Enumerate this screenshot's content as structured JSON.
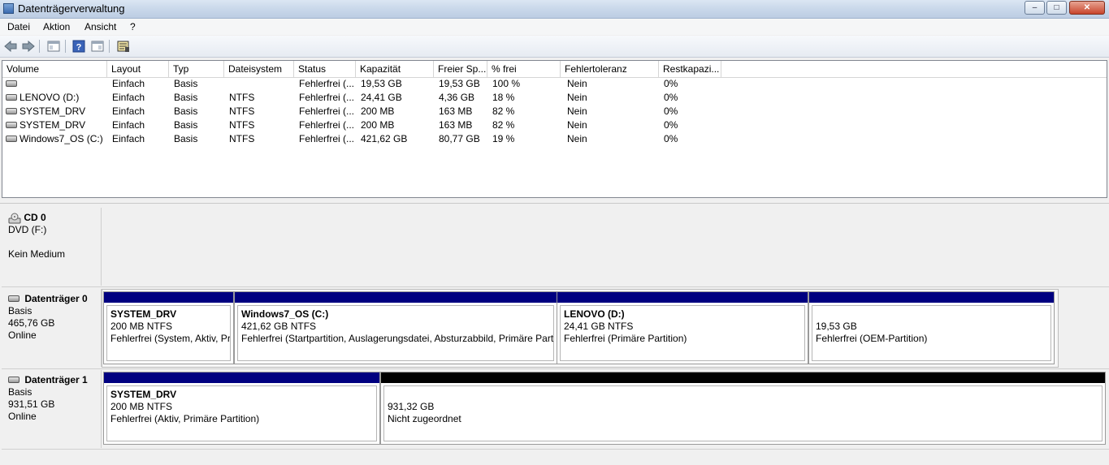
{
  "window": {
    "title": "Datenträgerverwaltung",
    "btn_min": "–",
    "btn_max": "□",
    "btn_close": "✕"
  },
  "menu": [
    "Datei",
    "Aktion",
    "Ansicht",
    "?"
  ],
  "toolbar": [
    "back-icon",
    "forward-icon",
    "console-tree-icon",
    "help-icon",
    "properties-icon",
    "disk-settings-icon"
  ],
  "columns": [
    "Volume",
    "Layout",
    "Typ",
    "Dateisystem",
    "Status",
    "Kapazität",
    "Freier Sp...",
    "% frei",
    "Fehlertoleranz",
    "Restkapazi..."
  ],
  "volumes": [
    {
      "volume": "",
      "layout": "Einfach",
      "typ": "Basis",
      "fs": "",
      "status": "Fehlerfrei (...",
      "kap": "19,53 GB",
      "frei": "19,53 GB",
      "pct": "100 %",
      "fehler": "Nein",
      "rest": "0%"
    },
    {
      "volume": "LENOVO (D:)",
      "layout": "Einfach",
      "typ": "Basis",
      "fs": "NTFS",
      "status": "Fehlerfrei (...",
      "kap": "24,41 GB",
      "frei": "4,36 GB",
      "pct": "18 %",
      "fehler": "Nein",
      "rest": "0%"
    },
    {
      "volume": "SYSTEM_DRV",
      "layout": "Einfach",
      "typ": "Basis",
      "fs": "NTFS",
      "status": "Fehlerfrei (...",
      "kap": "200 MB",
      "frei": "163 MB",
      "pct": "82 %",
      "fehler": "Nein",
      "rest": "0%"
    },
    {
      "volume": "SYSTEM_DRV",
      "layout": "Einfach",
      "typ": "Basis",
      "fs": "NTFS",
      "status": "Fehlerfrei (...",
      "kap": "200 MB",
      "frei": "163 MB",
      "pct": "82 %",
      "fehler": "Nein",
      "rest": "0%"
    },
    {
      "volume": "Windows7_OS (C:)",
      "layout": "Einfach",
      "typ": "Basis",
      "fs": "NTFS",
      "status": "Fehlerfrei (...",
      "kap": "421,62 GB",
      "frei": "80,77 GB",
      "pct": "19 %",
      "fehler": "Nein",
      "rest": "0%"
    }
  ],
  "disks": {
    "cd0": {
      "title": "CD 0",
      "line1": "DVD (F:)",
      "line2": "Kein Medium"
    },
    "disk0": {
      "title": "Datenträger 0",
      "type": "Basis",
      "size": "465,76 GB",
      "state": "Online",
      "partitions": [
        {
          "name": "SYSTEM_DRV",
          "size": "200 MB NTFS",
          "status": "Fehlerfrei (System, Aktiv, Pri"
        },
        {
          "name": "Windows7_OS  (C:)",
          "size": "421,62 GB NTFS",
          "status": "Fehlerfrei (Startpartition, Auslagerungsdatei, Absturzabbild, Primäre Parti"
        },
        {
          "name": "LENOVO  (D:)",
          "size": "24,41 GB NTFS",
          "status": "Fehlerfrei (Primäre Partition)"
        },
        {
          "name": "",
          "size": "19,53 GB",
          "status": "Fehlerfrei (OEM-Partition)"
        }
      ]
    },
    "disk1": {
      "title": "Datenträger 1",
      "type": "Basis",
      "size": "931,51 GB",
      "state": "Online",
      "partitions": [
        {
          "name": "SYSTEM_DRV",
          "size": "200 MB NTFS",
          "status": "Fehlerfrei (Aktiv, Primäre Partition)"
        },
        {
          "name": "",
          "size": "931,32 GB",
          "status": "Nicht zugeordnet"
        }
      ]
    }
  },
  "colors": {
    "primary_partition": "#000080",
    "unallocated": "#000000"
  }
}
